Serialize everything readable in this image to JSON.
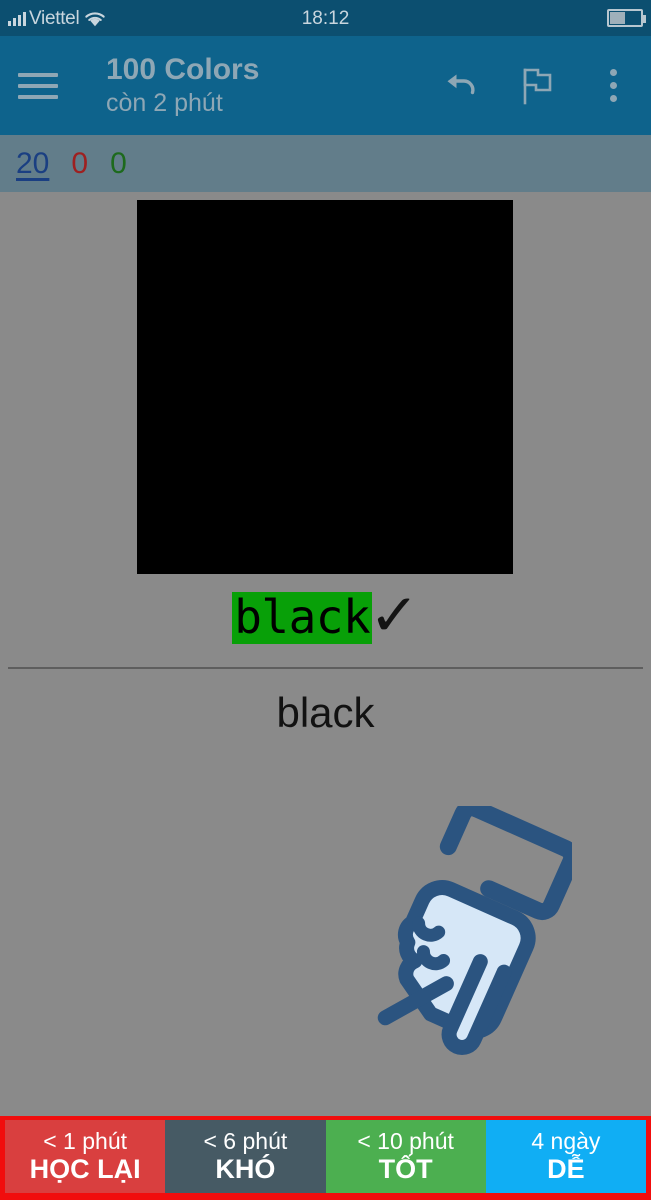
{
  "status_bar": {
    "carrier": "Viettel",
    "signal_icon": "signal-bars-icon",
    "wifi_icon": "wifi-icon",
    "time": "18:12",
    "battery_icon": "battery-icon"
  },
  "toolbar": {
    "menu_icon": "hamburger-menu-icon",
    "title": "100 Colors",
    "subtitle": "còn 2 phút",
    "undo_icon": "undo-arrow-icon",
    "flag_icon": "flag-icon",
    "more_icon": "more-vertical-icon",
    "background_color": "#0e638c",
    "text_color": "#8ea7b5"
  },
  "counters": {
    "new": "20",
    "learning": "0",
    "due": "0",
    "new_color": "#1a3f82",
    "learning_color": "#9e2020",
    "due_color": "#1d6a1d",
    "background_color": "#627d8a"
  },
  "card": {
    "background_color": "#8a8a8a",
    "swatch_color": "#000000",
    "question_word": "black",
    "question_highlight_color": "#08a008",
    "correct_mark": "✓",
    "answer": "black",
    "hand_icon": "pointing-hand-tap-icon",
    "hand_outline_color": "#2b5480",
    "hand_fill_color": "#d6e7f7"
  },
  "answer_buttons": [
    {
      "time": "< 1 phút",
      "label": "HỌC LẠI",
      "color": "#d93f3f",
      "name": "again"
    },
    {
      "time": "< 6 phút",
      "label": "KHÓ",
      "color": "#465a64",
      "name": "hard"
    },
    {
      "time": "< 10 phút",
      "label": "TỐT",
      "color": "#4caf50",
      "name": "good"
    },
    {
      "time": "4 ngày",
      "label": "DỄ",
      "color": "#10aef4",
      "name": "easy"
    }
  ],
  "answer_bar_border_color": "#f10d0d"
}
